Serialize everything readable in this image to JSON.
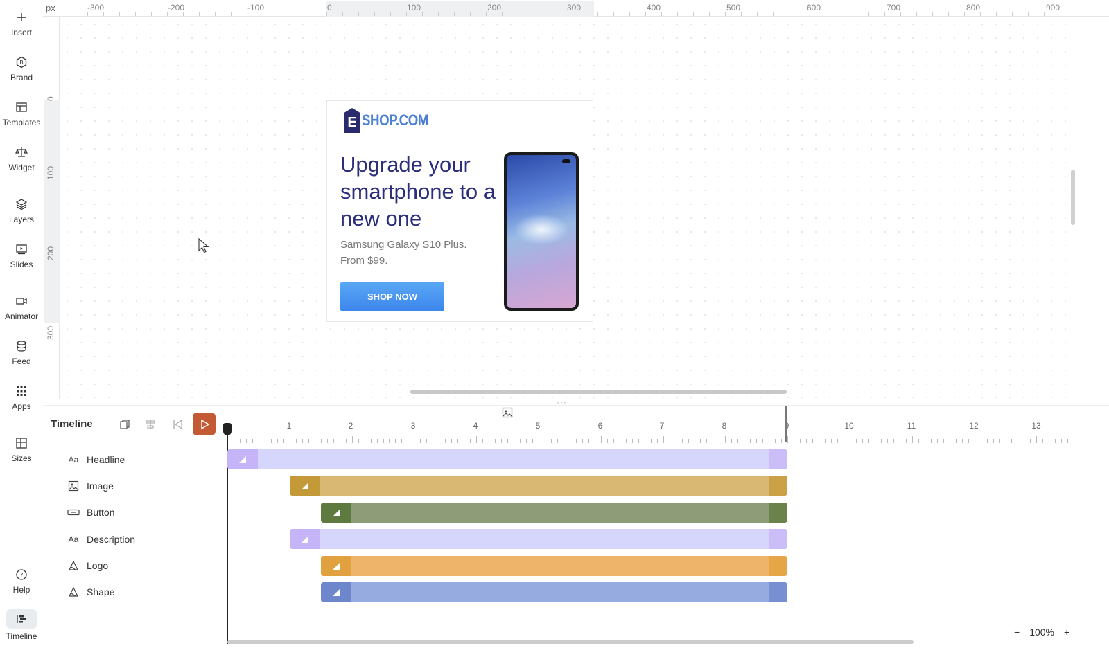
{
  "sidebar": {
    "items": [
      {
        "label": "Insert",
        "icon": "plus-icon"
      },
      {
        "label": "Brand",
        "icon": "brand-badge-icon"
      },
      {
        "label": "Templates",
        "icon": "templates-icon"
      },
      {
        "label": "Widget",
        "icon": "widget-scale-icon"
      },
      {
        "label": "Layers",
        "icon": "layers-icon"
      },
      {
        "label": "Slides",
        "icon": "slides-icon"
      },
      {
        "label": "Animator",
        "icon": "video-camera-icon"
      },
      {
        "label": "Feed",
        "icon": "database-icon"
      },
      {
        "label": "Apps",
        "icon": "grid-icon"
      },
      {
        "label": "Sizes",
        "icon": "sizes-icon"
      },
      {
        "label": "Help",
        "icon": "help-circle-icon"
      },
      {
        "label": "Timeline",
        "icon": "timeline-icon",
        "active": true
      }
    ]
  },
  "ruler": {
    "unit": "px",
    "top_ticks": [
      "-300",
      "-200",
      "-100",
      "0",
      "100",
      "200",
      "300",
      "400",
      "500",
      "600",
      "700",
      "800",
      "900"
    ],
    "left_ticks": [
      "0",
      "100",
      "200",
      "300"
    ]
  },
  "ad": {
    "logo_letter": "E",
    "logo_text": "SHOP.COM",
    "headline": "Upgrade your smartphone to a new one",
    "description": "Samsung Galaxy S10 Plus. From $99.",
    "button_label": "SHOP NOW",
    "colors": {
      "headline": "#2b2e7a",
      "button": "#4a90ee",
      "logo": "#4a7fd4"
    }
  },
  "timeline": {
    "title": "Timeline",
    "play_color": "#c35a34",
    "scale_numbers": [
      "1",
      "2",
      "3",
      "4",
      "5",
      "6",
      "7",
      "8",
      "9",
      "10",
      "11",
      "12",
      "13"
    ],
    "layers": [
      {
        "label": "Headline",
        "icon_text": "Aa",
        "icon": "text-icon",
        "start": 0,
        "end": 9,
        "color": "#d6d5fb",
        "cap": "#c5b4f7"
      },
      {
        "label": "Image",
        "icon_text": "",
        "icon": "image-icon",
        "start": 1,
        "end": 9,
        "color": "#d9b874",
        "cap": "#c49a38"
      },
      {
        "label": "Button",
        "icon_text": "",
        "icon": "button-icon",
        "start": 1.5,
        "end": 9,
        "color": "#8e9c78",
        "cap": "#5f7a3e"
      },
      {
        "label": "Description",
        "icon_text": "Aa",
        "icon": "text-icon",
        "start": 1,
        "end": 9,
        "color": "#d6d5fb",
        "cap": "#c5b4f7"
      },
      {
        "label": "Logo",
        "icon_text": "",
        "icon": "shape-icon",
        "start": 1.5,
        "end": 9,
        "color": "#eeb56a",
        "cap": "#e1a13e"
      },
      {
        "label": "Shape",
        "icon_text": "",
        "icon": "shape-icon",
        "start": 1.5,
        "end": 9,
        "color": "#96abe0",
        "cap": "#6e86cc"
      }
    ]
  },
  "zoom": {
    "minus": "−",
    "value": "100%",
    "plus": "+"
  }
}
